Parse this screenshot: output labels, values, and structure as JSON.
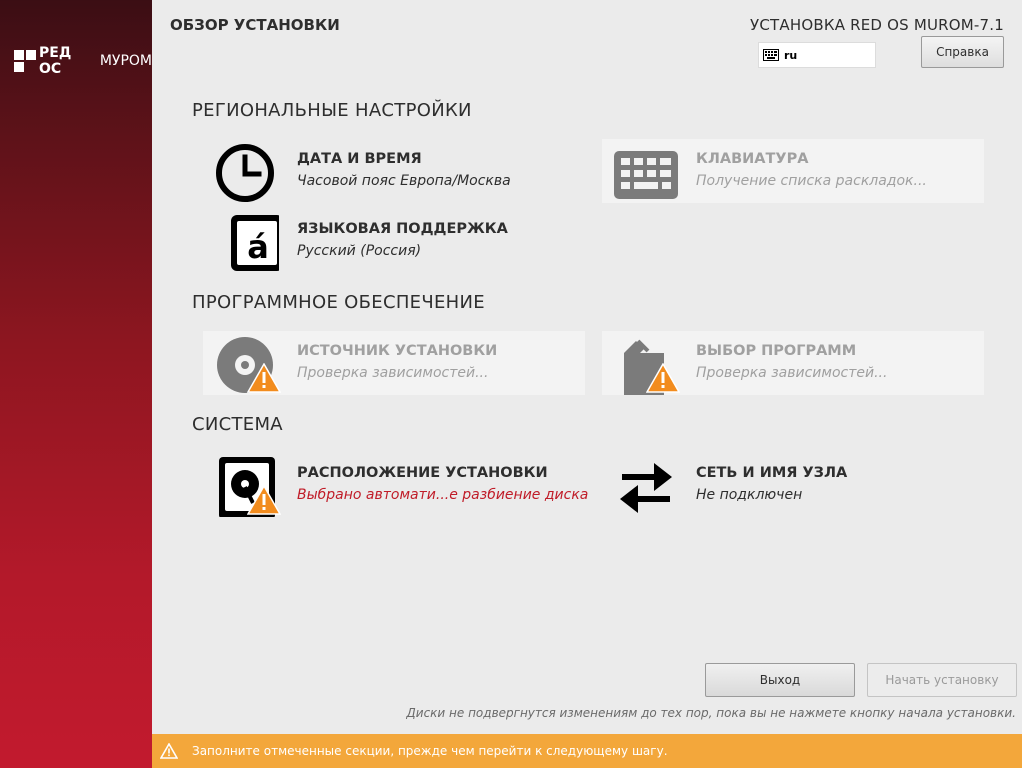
{
  "brand": {
    "logo_bold": "РЕД ОС",
    "logo_light": "МУРОМ"
  },
  "header": {
    "title": "ОБЗОР УСТАНОВКИ",
    "product": "УСТАНОВКА RED OS MUROM-7.1",
    "keyboard_layout": "ru",
    "help_label": "Справка"
  },
  "sections": {
    "localization": "РЕГИОНАЛЬНЫЕ НАСТРОЙКИ",
    "software": "ПРОГРАММНОЕ ОБЕСПЕЧЕНИЕ",
    "system": "СИСТЕМА"
  },
  "spokes": {
    "datetime": {
      "title": "ДАТА И ВРЕМЯ",
      "status": "Часовой пояс Европа/Москва",
      "icon": "clock-icon"
    },
    "keyboard": {
      "title": "КЛАВИАТУРА",
      "status": "Получение списка раскладок...",
      "icon": "keyboard-icon"
    },
    "language": {
      "title": "ЯЗЫКОВАЯ ПОДДЕРЖКА",
      "status": "Русский (Россия)",
      "icon": "language-icon"
    },
    "source": {
      "title": "ИСТОЧНИК УСТАНОВКИ",
      "status": "Проверка зависимостей...",
      "icon": "disc-icon"
    },
    "software": {
      "title": "ВЫБОР ПРОГРАММ",
      "status": "Проверка зависимостей...",
      "icon": "package-icon"
    },
    "storage": {
      "title": "РАСПОЛОЖЕНИЕ УСТАНОВКИ",
      "status": "Выбрано автомати...е разбиение диска",
      "icon": "harddisk-icon"
    },
    "network": {
      "title": "СЕТЬ И ИМЯ УЗЛА",
      "status": "Не подключен",
      "icon": "network-arrows-icon"
    }
  },
  "footer": {
    "quit_label": "Выход",
    "begin_label": "Начать установку",
    "note": "Диски не подвергнутся изменениям до тех пор, пока вы не нажмете кнопку начала установки.",
    "warning": "Заполните отмеченные секции, прежде чем перейти к следующему шагу."
  },
  "colors": {
    "sidebar_top": "#3b0e14",
    "sidebar_bottom": "#c21a2e",
    "warning_bar": "#f3a73b",
    "warning_triangle": "#f28c1e",
    "error_text": "#c01c28"
  }
}
